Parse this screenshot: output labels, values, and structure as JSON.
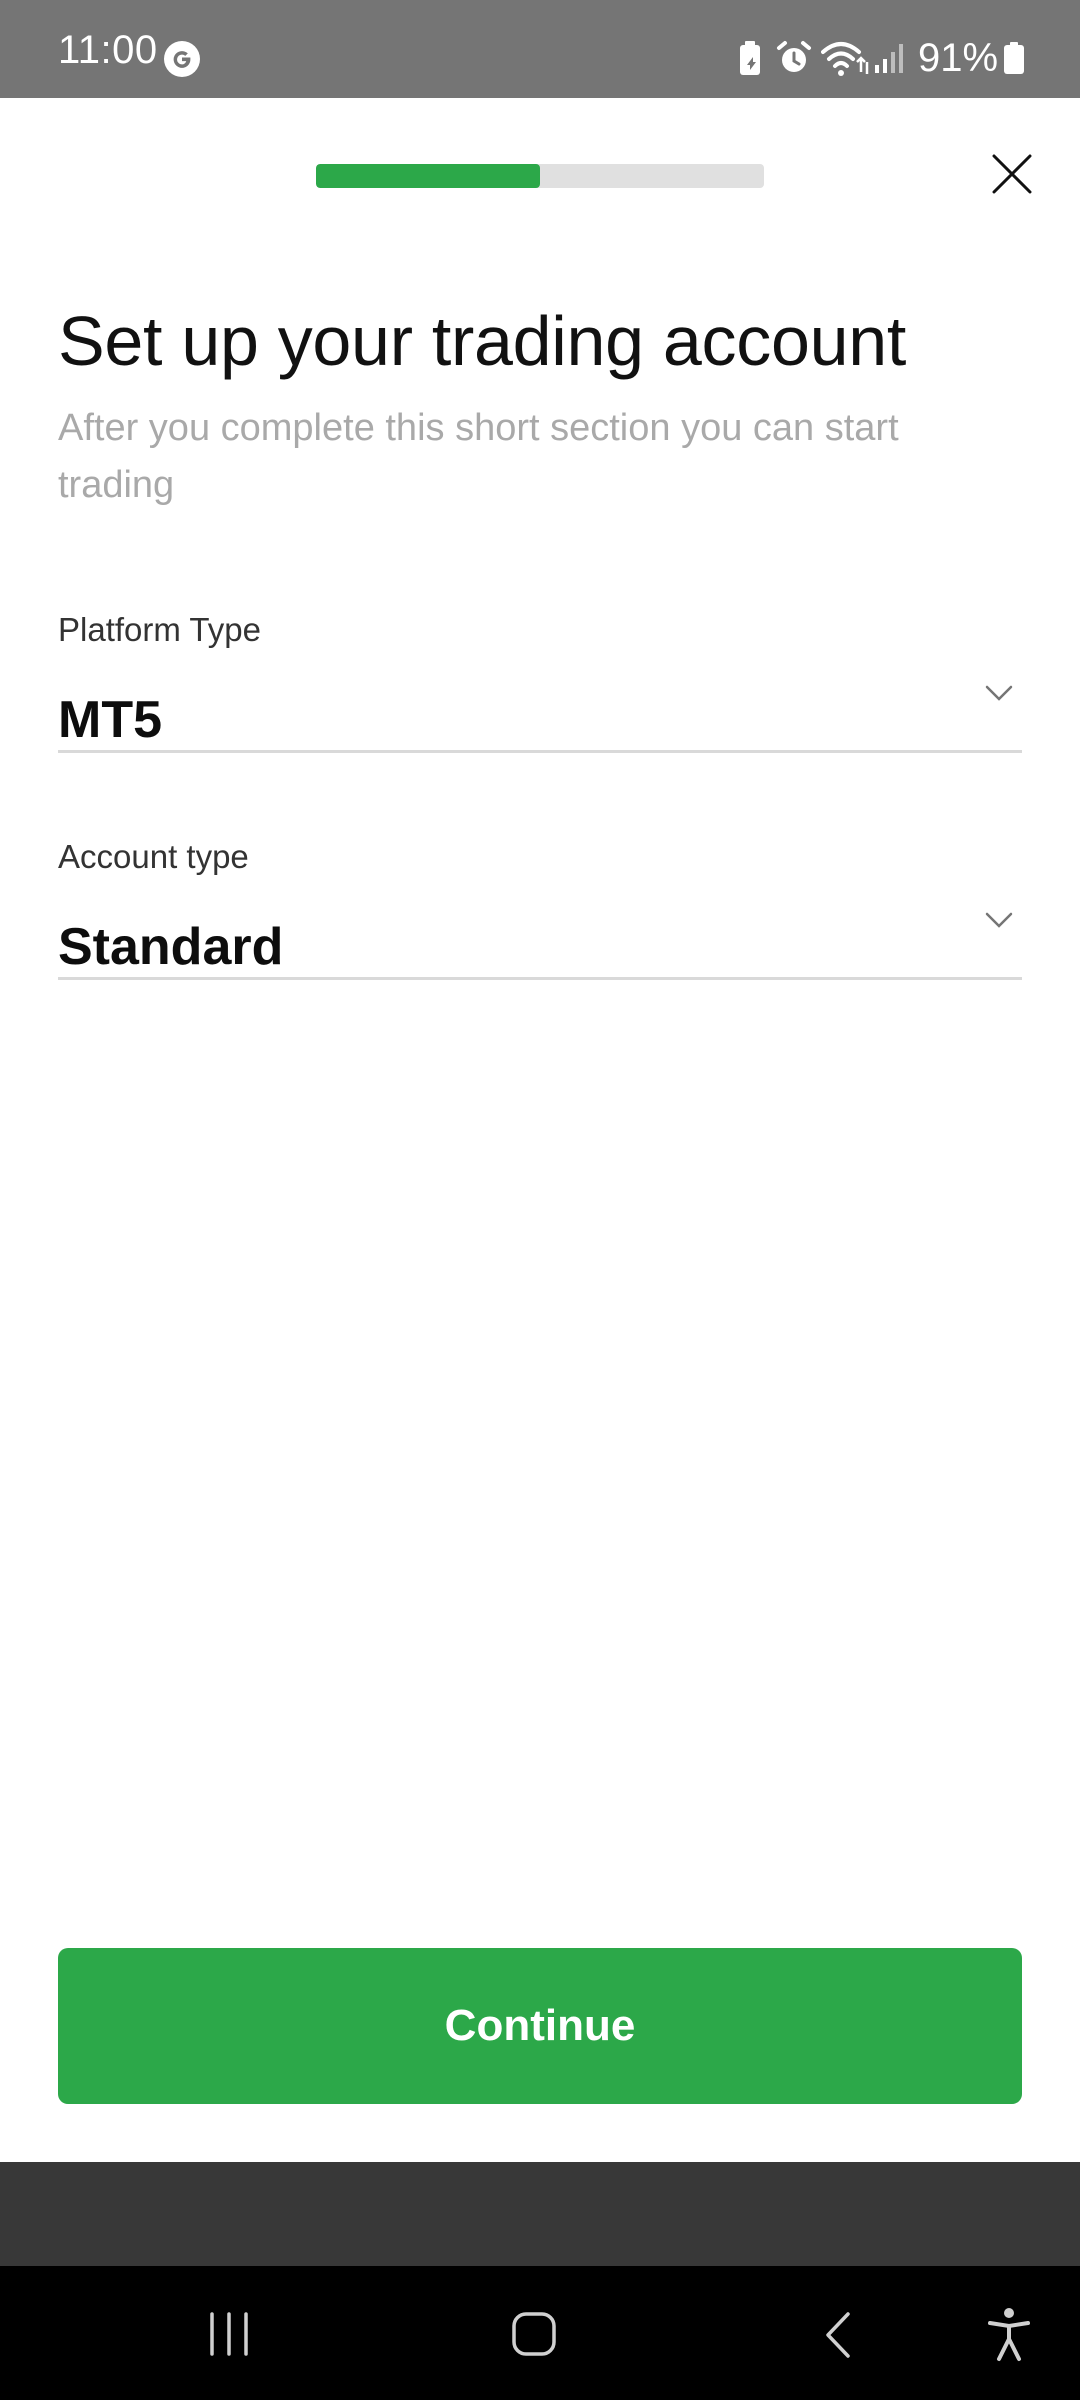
{
  "status_bar": {
    "time": "11:00",
    "battery_percent": "91%",
    "icons": [
      "google-g-icon",
      "battery-saver-icon",
      "alarm-icon",
      "wifi-icon",
      "signal-icon",
      "battery-icon"
    ]
  },
  "header": {
    "progress_fraction": 0.5,
    "close_icon": "close-icon"
  },
  "main": {
    "title": "Set up your trading account",
    "subtitle": "After you complete this short section you can start trading",
    "fields": [
      {
        "label": "Platform Type",
        "value": "MT5"
      },
      {
        "label": "Account type",
        "value": "Standard"
      }
    ]
  },
  "footer": {
    "continue_label": "Continue"
  },
  "nav_bar": {
    "buttons": [
      "recent-apps-icon",
      "home-icon",
      "back-icon",
      "accessibility-icon"
    ]
  },
  "colors": {
    "accent": "#2ca849",
    "status_bar": "#757575",
    "progress_track": "#e0e0e0",
    "subtitle": "#a9a9a9"
  }
}
